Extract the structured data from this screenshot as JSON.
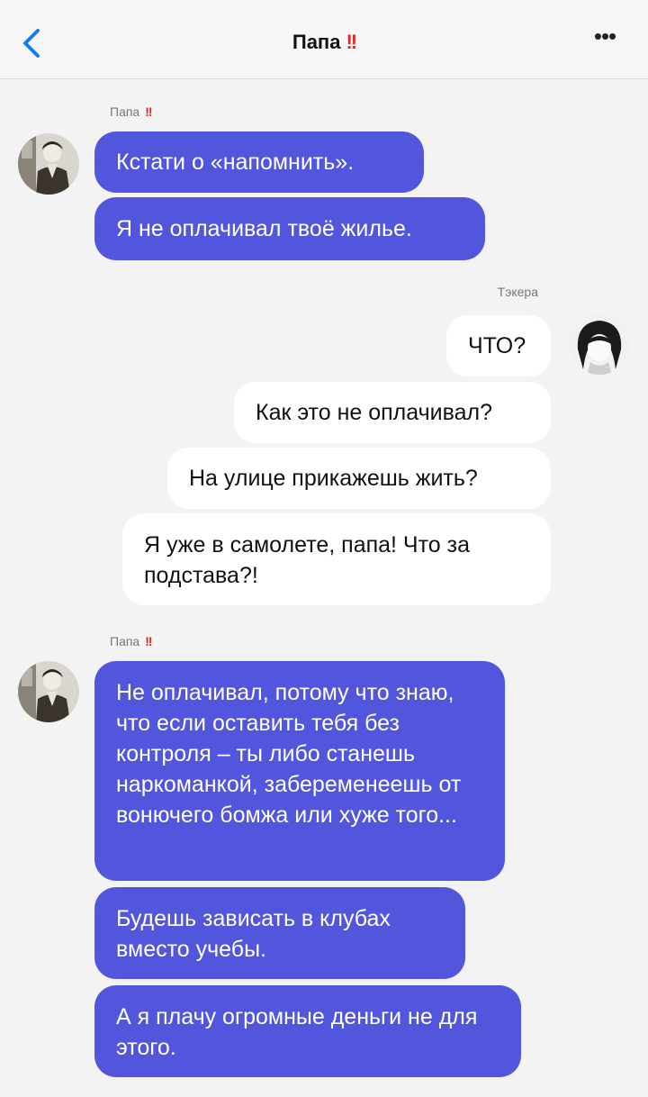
{
  "header": {
    "title": "Папа",
    "title_mark": "!!",
    "back_icon": "chevron-left-icon",
    "more_label": "•••"
  },
  "colors": {
    "incoming_bubble": "#5256dc",
    "outgoing_bubble": "#ffffff",
    "accent": "#1a7cf5",
    "warning_mark": "#e8251f"
  },
  "groups": [
    {
      "sender": "Папа",
      "sender_mark": "!!",
      "messages": [
        "Кстати о «напомнить».",
        "Я не оплачивал твоё жилье."
      ]
    },
    {
      "sender": "Тэкера",
      "messages": [
        "ЧТО?",
        "Как это не оплачивал?",
        "На улице прикажешь жить?",
        "Я уже в самолете, папа! Что за подстава?!"
      ]
    },
    {
      "sender": "Папа",
      "sender_mark": "!!",
      "messages": [
        "Не оплачивал, потому что знаю, что если оставить тебя без контроля – ты либо станешь наркоманкой, забеременеешь от вонючего бомжа или хуже того...",
        "Будешь зависать в клубах вместо учебы.",
        "А я плачу огромные деньги не для этого."
      ]
    }
  ]
}
